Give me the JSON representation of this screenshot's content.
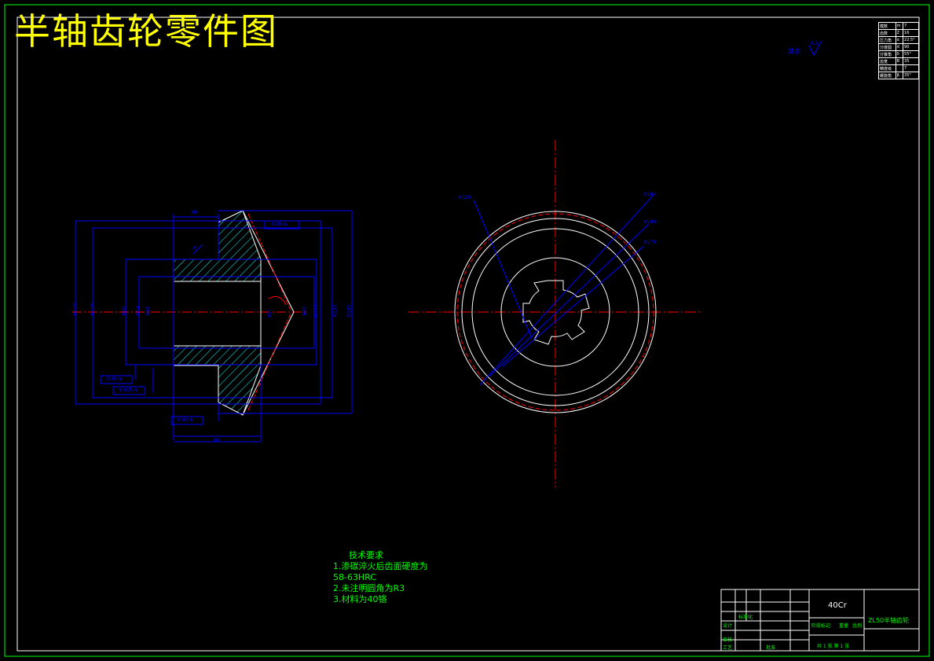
{
  "title": "半轴齿轮零件图",
  "roughness_note": "其余",
  "roughness_value": "6.3",
  "params_table": [
    [
      "模数",
      "m",
      "7"
    ],
    [
      "齿数",
      "Z",
      "16"
    ],
    [
      "压力角",
      "α",
      "22.5°"
    ],
    [
      "分度圆",
      "d",
      "90"
    ],
    [
      "分锥角",
      "δ",
      "55°"
    ],
    [
      "齿宽",
      "B",
      "35"
    ],
    [
      "精度级",
      "",
      "7"
    ],
    [
      "螺旋角",
      "β",
      "35°"
    ]
  ],
  "dimensions": {
    "left_top": "40",
    "left_bottom": "80",
    "d1": "Φ170",
    "d2": "Φ125",
    "d3": "Φ80",
    "d4": "Φ54",
    "d5": "Φ60",
    "d6": "Φ85",
    "d7": "Φ125",
    "d8": "Φ150",
    "d9": "Φ185",
    "angle": "60°",
    "r_top": "Φ184",
    "r_mid": "Φ180",
    "r_low": "Φ170",
    "r_left": "Φ120"
  },
  "tolerance_frames": [
    "0.05 A",
    "0.05 A",
    "0.035 A",
    "0.03 A"
  ],
  "datum": "A",
  "tech_requirements": {
    "heading": "技术要求",
    "items": [
      "1.渗碳淬火后齿面硬度为",
      "58-63HRC",
      "2.未注明圆角为R3",
      "3.材料为40铬"
    ]
  },
  "title_block": {
    "material": "40Cr",
    "part_name": "ZL50半轴齿轮",
    "labels": [
      "设计",
      "审核",
      "工艺",
      "标准化",
      "批准",
      "阶段标记",
      "重量",
      "比例",
      "共 1 张 第 1 张"
    ]
  }
}
